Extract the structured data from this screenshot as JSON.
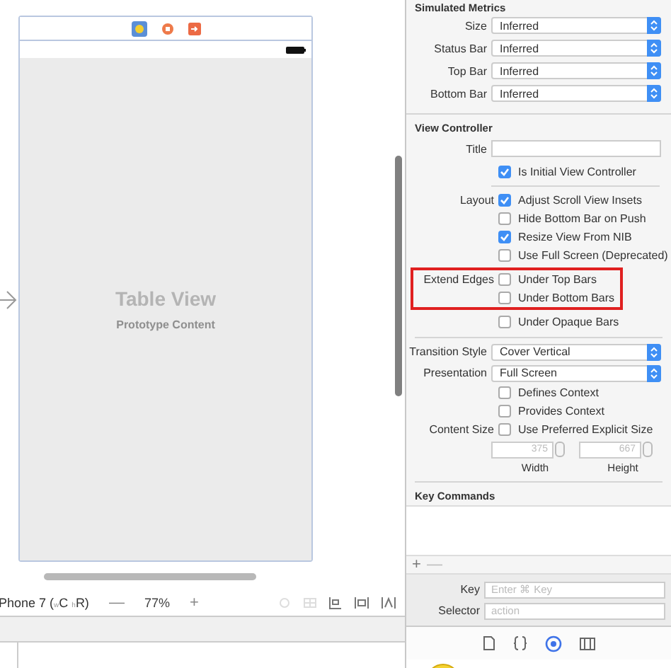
{
  "canvas": {
    "scene_title": "Table View",
    "scene_subtitle": "Prototype Content"
  },
  "canvas_toolbar": {
    "device": "Phone 7 ($_{w}$C $_{h}$R)",
    "zoom_out": "—",
    "zoom": "77%",
    "zoom_in": "+"
  },
  "inspector": {
    "metrics_heading": "Simulated Metrics",
    "metrics": [
      {
        "label": "Size",
        "value": "Inferred"
      },
      {
        "label": "Status Bar",
        "value": "Inferred"
      },
      {
        "label": "Top Bar",
        "value": "Inferred"
      },
      {
        "label": "Bottom Bar",
        "value": "Inferred"
      }
    ],
    "vc_heading": "View Controller",
    "title_field": {
      "label": "Title"
    },
    "option_groups": [
      {
        "highlighted": false,
        "items": [
          {
            "text": "Is Initial View Controller",
            "checked": true
          }
        ]
      },
      {
        "label": "Layout",
        "highlighted": false,
        "items": [
          {
            "text": "Adjust Scroll View Insets",
            "checked": true
          },
          {
            "text": "Hide Bottom Bar on Push",
            "checked": false
          },
          {
            "text": "Resize View From NIB",
            "checked": true
          },
          {
            "text": "Use Full Screen (Deprecated)",
            "checked": false
          }
        ]
      },
      {
        "label": "Extend Edges",
        "highlighted": true,
        "items": [
          {
            "text": "Under Top Bars",
            "checked": false
          },
          {
            "text": "Under Bottom Bars",
            "checked": false
          }
        ]
      },
      {
        "highlighted": false,
        "items": [
          {
            "text": "Under Opaque Bars",
            "checked": false
          }
        ]
      }
    ],
    "selects": [
      {
        "label": "Transition Style",
        "value": "Cover Vertical"
      },
      {
        "label": "Presentation",
        "value": "Full Screen"
      }
    ],
    "context_options": [
      {
        "text": "Defines Context",
        "checked": false
      },
      {
        "text": "Provides Context",
        "checked": false
      }
    ],
    "content_size": {
      "label": "Content Size",
      "text": "Use Preferred Explicit Size",
      "checked": false,
      "fields": [
        {
          "placeholder": "375",
          "caption": "Width"
        },
        {
          "placeholder": "667",
          "caption": "Height"
        }
      ]
    },
    "key_commands": {
      "heading": "Key Commands",
      "add": "+",
      "remove": "—",
      "fields": [
        {
          "label": "Key",
          "placeholder": "Enter ⌘ Key"
        },
        {
          "label": "Selector",
          "placeholder": "action"
        }
      ]
    },
    "tabs": [
      {
        "kind": "file",
        "selected": false
      },
      {
        "kind": "braces",
        "selected": false
      },
      {
        "kind": "identity",
        "selected": true
      },
      {
        "kind": "size",
        "selected": false
      }
    ]
  }
}
